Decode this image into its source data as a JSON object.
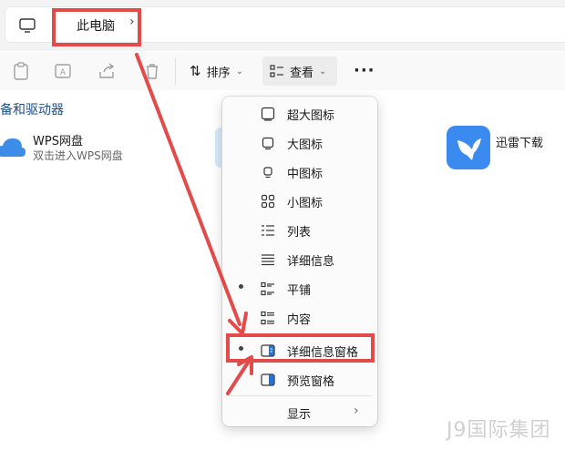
{
  "address_bar": {
    "breadcrumb": "此电脑"
  },
  "toolbar": {
    "sort_label": "排序",
    "view_label": "查看",
    "more_label": "···"
  },
  "section": {
    "title": "备和驱动器"
  },
  "items": [
    {
      "name": "WPS网盘",
      "desc": "双击进入WPS网盘"
    },
    {
      "name": "迅雷下载"
    }
  ],
  "view_menu": {
    "items": [
      {
        "label": "超大图标",
        "icon": "extra-large-icons-icon"
      },
      {
        "label": "大图标",
        "icon": "large-icons-icon"
      },
      {
        "label": "中图标",
        "icon": "medium-icons-icon"
      },
      {
        "label": "小图标",
        "icon": "small-icons-icon"
      },
      {
        "label": "列表",
        "icon": "list-icon"
      },
      {
        "label": "详细信息",
        "icon": "details-icon"
      },
      {
        "label": "平铺",
        "icon": "tiles-icon",
        "selected": true
      },
      {
        "label": "内容",
        "icon": "content-icon"
      },
      {
        "label": "详细信息窗格",
        "icon": "details-pane-icon",
        "selected": true
      },
      {
        "label": "预览窗格",
        "icon": "preview-pane-icon"
      },
      {
        "label": "显示",
        "has_submenu": true
      }
    ]
  },
  "colors": {
    "annotation": "#e34b4b",
    "accent": "#1a73e8"
  },
  "watermark": "J9国际集团"
}
